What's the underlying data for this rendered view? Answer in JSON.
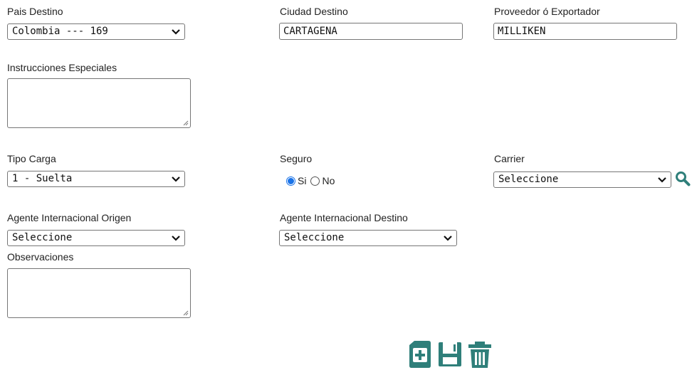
{
  "form": {
    "pais_destino": {
      "label": "Pais Destino",
      "value": "Colombia --- 169"
    },
    "ciudad_destino": {
      "label": "Ciudad Destino",
      "value": "CARTAGENA"
    },
    "proveedor": {
      "label": "Proveedor ó Exportador",
      "value": "MILLIKEN"
    },
    "instrucciones": {
      "label": "Instrucciones Especiales",
      "value": ""
    },
    "tipo_carga": {
      "label": "Tipo Carga",
      "value": "1 - Suelta"
    },
    "seguro": {
      "label": "Seguro",
      "option_si": "Si",
      "option_no": "No",
      "selected": "Si"
    },
    "carrier": {
      "label": "Carrier",
      "value": "Seleccione"
    },
    "agente_origen": {
      "label": "Agente Internacional Origen",
      "value": "Seleccione"
    },
    "agente_destino": {
      "label": "Agente Internacional Destino",
      "value": "Seleccione"
    },
    "observaciones": {
      "label": "Observaciones",
      "value": ""
    }
  },
  "icons": {
    "search": "magnifier-icon",
    "new": "new-document-icon",
    "save": "floppy-disk-icon",
    "delete": "trash-icon"
  },
  "colors": {
    "accent": "#2f7f7a",
    "radio": "#1a73e8"
  }
}
